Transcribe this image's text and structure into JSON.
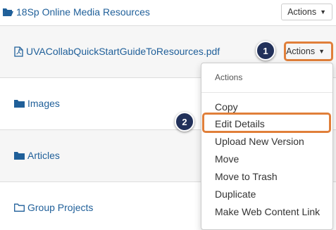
{
  "top_folder": {
    "name": "18Sp Online Media Resources",
    "icon": "folder-open-icon",
    "actions_label": "Actions"
  },
  "rows": [
    {
      "name": "UVACollabQuickStartGuideToResources.pdf",
      "icon": "pdf-file-icon",
      "actions_label": "Actions"
    },
    {
      "name": "Images",
      "icon": "folder-icon"
    },
    {
      "name": "Articles",
      "icon": "folder-icon"
    },
    {
      "name": "Group Projects",
      "icon": "folder-outline-icon"
    }
  ],
  "menu": {
    "header": "Actions",
    "items": [
      "Copy",
      "Edit Details",
      "Upload New Version",
      "Move",
      "Move to Trash",
      "Duplicate",
      "Make Web Content Link"
    ]
  },
  "callouts": {
    "step1": "1",
    "step2": "2"
  },
  "colors": {
    "link": "#1f5f99",
    "callout_border": "#e07f3a",
    "badge_bg": "#22315a"
  }
}
